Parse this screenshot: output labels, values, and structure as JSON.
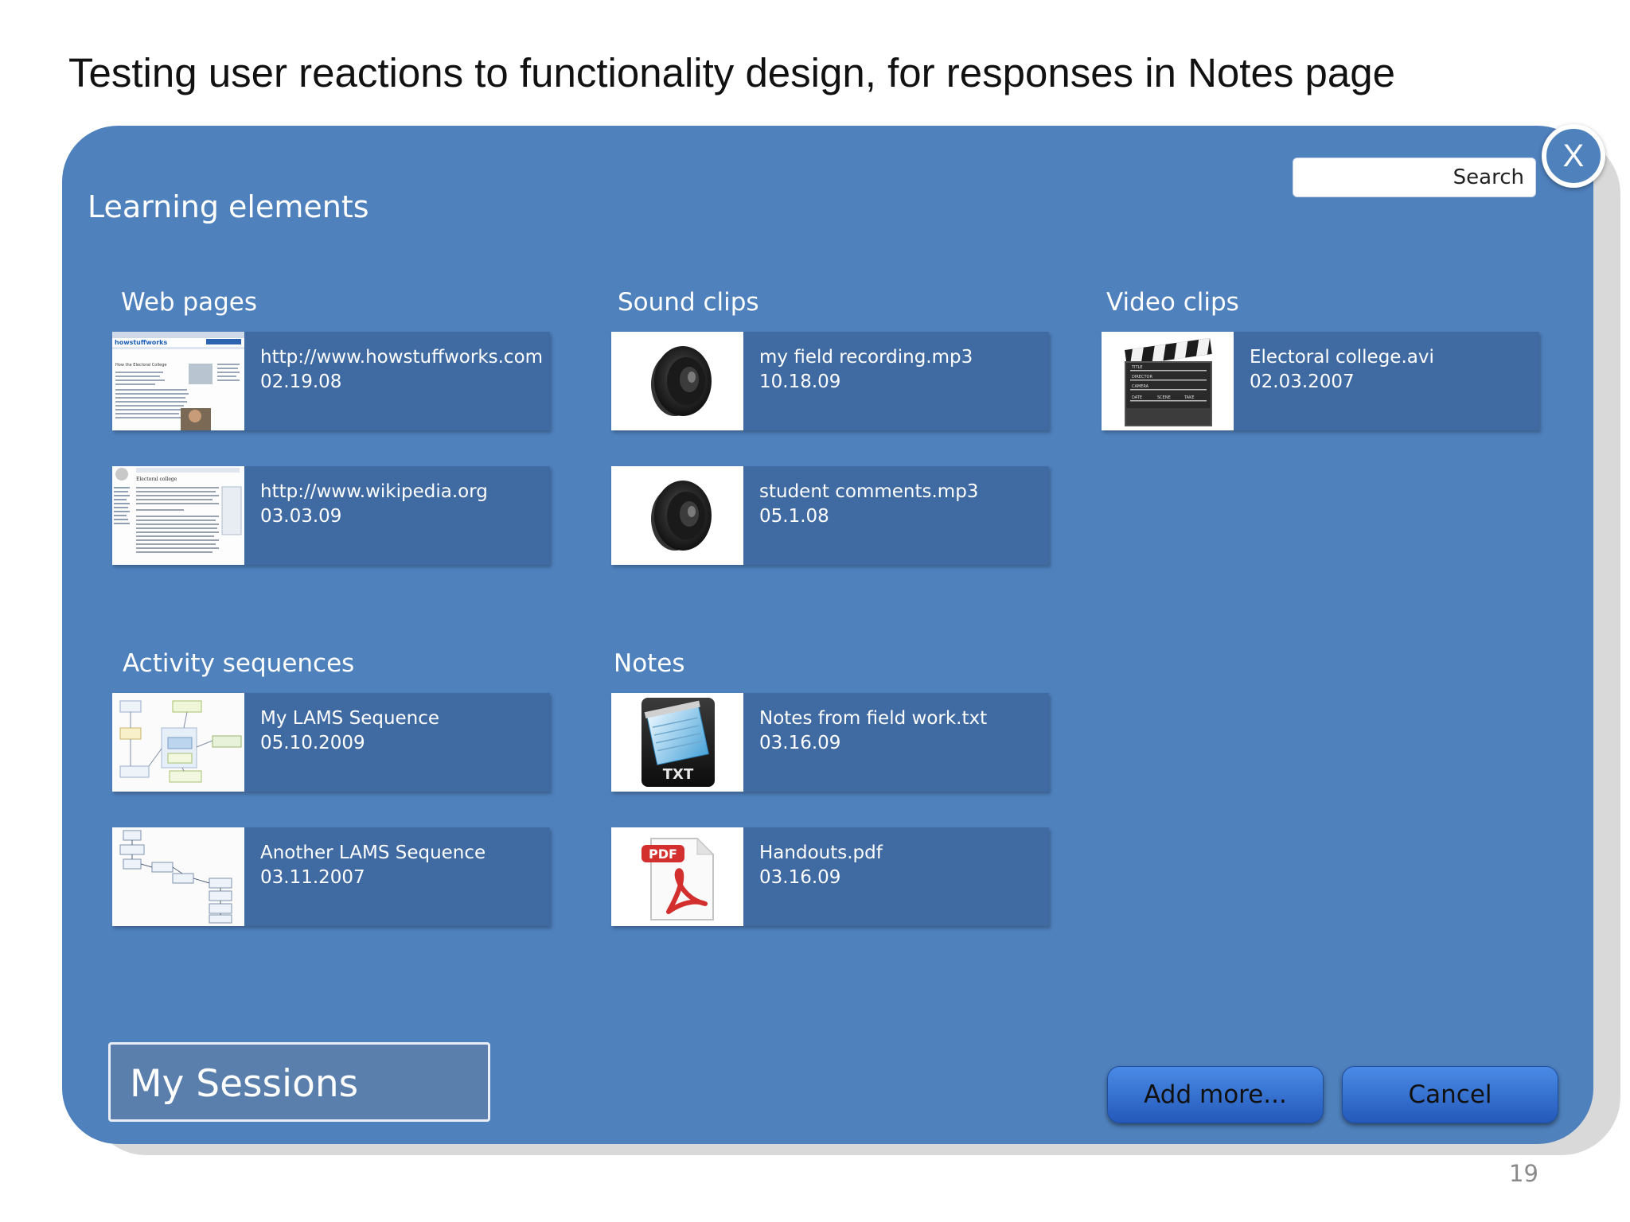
{
  "slide": {
    "title": "Testing user reactions to functionality design, for responses in Notes page",
    "page_number": "19"
  },
  "dialog": {
    "heading": "Learning elements",
    "close_label": "X",
    "search": {
      "label": "Search",
      "placeholder": "Search"
    },
    "sections": {
      "web_pages": {
        "title": "Web pages",
        "items": [
          {
            "name": "http://www.howstuffworks.com",
            "date": "02.19.08",
            "icon": "webpage-thumbnail"
          },
          {
            "name": "http://www.wikipedia.org",
            "date": "03.03.09",
            "icon": "webpage-thumbnail"
          }
        ]
      },
      "sound_clips": {
        "title": "Sound clips",
        "items": [
          {
            "name": "my field recording.mp3",
            "date": "10.18.09",
            "icon": "speaker-icon"
          },
          {
            "name": "student comments.mp3",
            "date": "05.1.08",
            "icon": "speaker-icon"
          }
        ]
      },
      "video_clips": {
        "title": "Video clips",
        "items": [
          {
            "name": "Electoral college.avi",
            "date": "02.03.2007",
            "icon": "clapperboard-icon"
          }
        ]
      },
      "activity_sequences": {
        "title": "Activity sequences",
        "items": [
          {
            "name": "My LAMS Sequence",
            "date": "05.10.2009",
            "icon": "sequence-thumbnail"
          },
          {
            "name": "Another LAMS Sequence",
            "date": "03.11.2007",
            "icon": "sequence-thumbnail"
          }
        ]
      },
      "notes": {
        "title": "Notes",
        "items": [
          {
            "name": "Notes from field work.txt",
            "date": "03.16.09",
            "icon": "txt-file-icon",
            "badge": "TXT"
          },
          {
            "name": "Handouts.pdf",
            "date": "03.16.09",
            "icon": "pdf-file-icon",
            "badge": "PDF"
          }
        ]
      }
    },
    "my_sessions_label": "My Sessions",
    "buttons": {
      "add_more": "Add more...",
      "cancel": "Cancel"
    }
  },
  "colors": {
    "panel": "#4f81bd",
    "item": "#3f6aa2",
    "button_top": "#4a8be6",
    "button_bottom": "#2459b9"
  }
}
